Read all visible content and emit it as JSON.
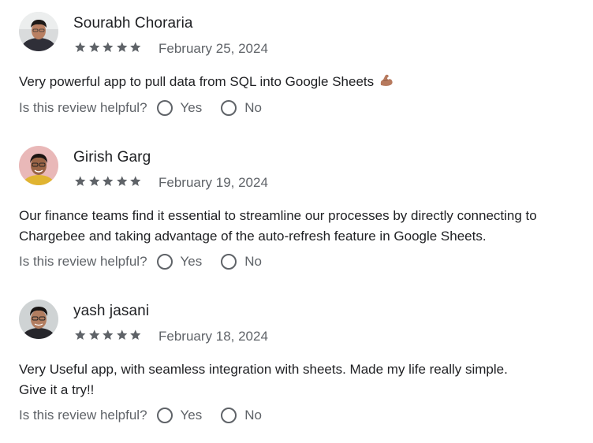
{
  "reviews": [
    {
      "author": "Sourabh Choraria",
      "rating": 5,
      "date": "February 25, 2024",
      "lines": [
        "Very powerful app to pull data from SQL into Google Sheets"
      ],
      "emoji": "flexed-biceps-emoji",
      "helpful_prompt": "Is this review helpful?",
      "yes_label": "Yes",
      "no_label": "No",
      "avatar_icon": "user-photo-avatar"
    },
    {
      "author": "Girish Garg",
      "rating": 5,
      "date": "February 19, 2024",
      "lines": [
        "Our finance teams find it essential to streamline our processes by directly connecting to",
        "Chargebee and taking advantage of the auto-refresh feature in Google Sheets."
      ],
      "helpful_prompt": "Is this review helpful?",
      "yes_label": "Yes",
      "no_label": "No",
      "avatar_icon": "user-photo-avatar"
    },
    {
      "author": "yash jasani",
      "rating": 5,
      "date": "February 18, 2024",
      "lines": [
        "Very Useful app, with seamless integration with sheets. Made my life really simple.",
        "Give it a try!!"
      ],
      "helpful_prompt": "Is this review helpful?",
      "yes_label": "Yes",
      "no_label": "No",
      "avatar_icon": "user-photo-avatar"
    }
  ],
  "colors": {
    "star": "#5f6368",
    "text": "#202124",
    "secondary": "#5f6368"
  }
}
